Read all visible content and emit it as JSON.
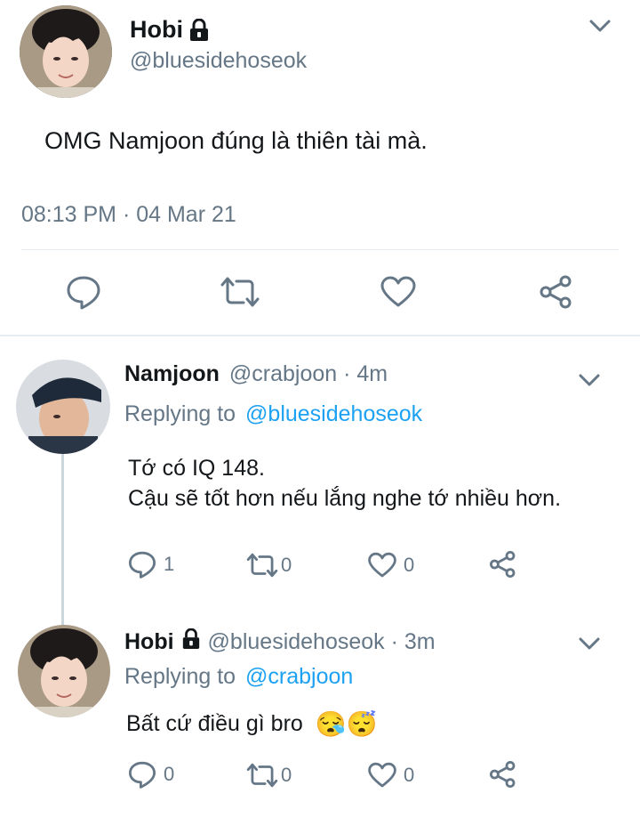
{
  "main_tweet": {
    "name": "Hobi",
    "handle": "@bluesidehoseok",
    "text": "OMG Namjoon đúng là thiên tài mà.",
    "timestamp": "08:13 PM · 04 Mar 21",
    "locked": true
  },
  "replies": [
    {
      "name": "Namjoon",
      "handle": "@crabjoon · 4m",
      "replying_prefix": "Replying to",
      "replying_to": "@bluesidehoseok",
      "text_line1": "Tớ có IQ 148.",
      "text_line2": "Cậu sẽ tốt hơn nếu lắng nghe tớ nhiều hơn.",
      "reply_count": "1",
      "retweet_count": "0",
      "like_count": "0"
    },
    {
      "name": "Hobi",
      "handle": "@bluesidehoseok · 3m",
      "replying_prefix": "Replying to",
      "replying_to": "@crabjoon",
      "text": "Bất cứ điều gì bro",
      "emojis": "😪😴",
      "reply_count": "0",
      "retweet_count": "0",
      "like_count": "0",
      "locked": true
    }
  ],
  "colors": {
    "text": "#14171a",
    "secondary": "#657786",
    "link": "#1da1f2",
    "divider": "#e6ecf0"
  }
}
